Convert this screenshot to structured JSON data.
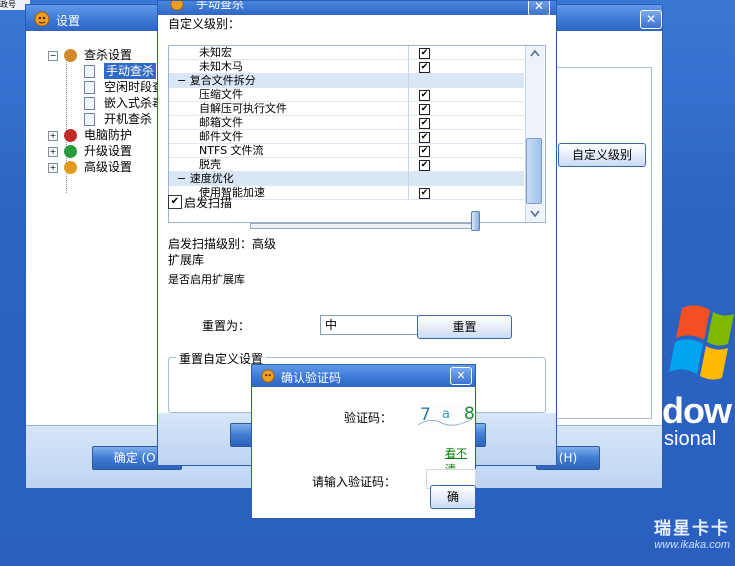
{
  "top_strip_text": "政号",
  "desktop": {
    "xp_text": "dow",
    "xp_sub": "sional",
    "watermark_brand": "瑞星卡卡",
    "watermark_url": "www.ikaka.com"
  },
  "settings": {
    "title": "设置",
    "close": "✕",
    "tree": [
      {
        "label": "查杀设置",
        "icon": "magnifier-icon"
      },
      {
        "label": "手动查杀",
        "icon": "page-icon",
        "selected": true
      },
      {
        "label": "空闲时段查",
        "icon": "page-icon"
      },
      {
        "label": "嵌入式杀毒",
        "icon": "page-icon"
      },
      {
        "label": "开机查杀",
        "icon": "page-icon"
      },
      {
        "label": "电脑防护",
        "icon": "shield-icon"
      },
      {
        "label": "升级设置",
        "icon": "update-icon"
      },
      {
        "label": "高级设置",
        "icon": "gears-icon"
      }
    ],
    "custom_level_button": "自定义级别",
    "ok_button": "确定 (O)",
    "right_button": "(H)"
  },
  "manual": {
    "title": "手动查杀",
    "custom_level_label": "自定义级别：",
    "rows": [
      {
        "label": "未知宏",
        "checked": "✔",
        "group": false
      },
      {
        "label": "未知木马",
        "checked": "✔",
        "group": false
      },
      {
        "label": "复合文件拆分",
        "checked": "",
        "group": true,
        "prefix": "−"
      },
      {
        "label": "压缩文件",
        "checked": "✔",
        "group": false
      },
      {
        "label": "自解压可执行文件",
        "checked": "✔",
        "group": false
      },
      {
        "label": "邮箱文件",
        "checked": "✔",
        "group": false
      },
      {
        "label": "邮件文件",
        "checked": "✔",
        "group": false
      },
      {
        "label": "NTFS 文件流",
        "checked": "✔",
        "group": false
      },
      {
        "label": "脱壳",
        "checked": "✔",
        "group": false
      },
      {
        "label": "速度优化",
        "checked": "",
        "group": true,
        "prefix": "−"
      },
      {
        "label": "使用智能加速",
        "checked": "✔",
        "group": false
      }
    ],
    "startup_scan_label": "启发扫描",
    "startup_scan_check": "✔",
    "slider_level": 1.0,
    "startup_level_text": "启发扫描级别：高级",
    "extlib_label": "扩展库",
    "extlib_question": "是否启用扩展库",
    "reset_label": "重置为：",
    "reset_value": "中",
    "reset_button": "重置",
    "reset_group_label": "重置自定义设置"
  },
  "captcha": {
    "title": "确认验证码",
    "close": "✕",
    "code_label": "验证码：",
    "code_chars": [
      "7",
      "a",
      "8"
    ],
    "hint": "看不清",
    "enter_label": "请输入验证码：",
    "ok_button": "确"
  }
}
